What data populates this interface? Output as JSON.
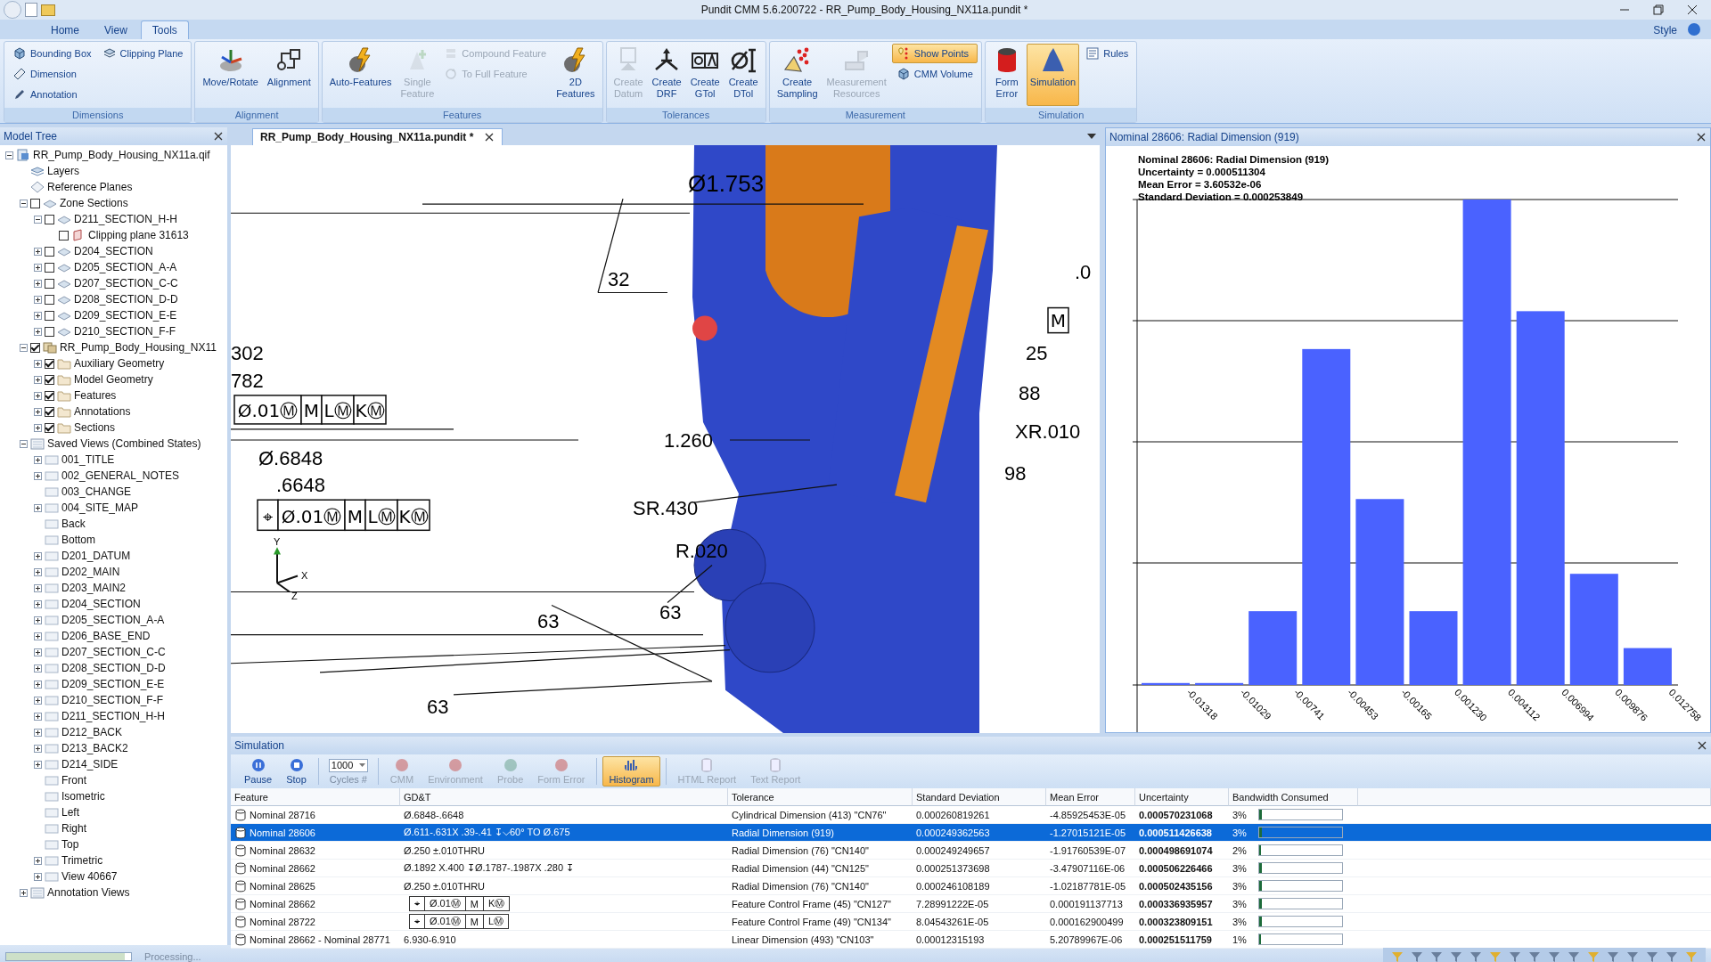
{
  "window": {
    "title": "Pundit CMM 5.6.200722 - RR_Pump_Body_Housing_NX11a.pundit *"
  },
  "ribbon_tabs": [
    {
      "label": "Home",
      "selected": false
    },
    {
      "label": "View",
      "selected": false
    },
    {
      "label": "Tools",
      "selected": true
    }
  ],
  "style_menu": "Style",
  "ribbon_groups": [
    {
      "label": "Dimensions",
      "items": [
        {
          "label": "Bounding Box",
          "kind": "small",
          "disabled": false,
          "selected": false
        },
        {
          "label": "Dimension",
          "kind": "small",
          "disabled": false,
          "selected": false
        },
        {
          "label": "Annotation",
          "kind": "small",
          "disabled": false,
          "selected": false
        },
        {
          "label": "Clipping Plane",
          "kind": "small",
          "disabled": false,
          "selected": false
        }
      ]
    },
    {
      "label": "Alignment",
      "items": [
        {
          "label": "Move/Rotate",
          "kind": "large",
          "disabled": false,
          "selected": false
        },
        {
          "label": "Alignment",
          "kind": "large",
          "disabled": false,
          "selected": false
        }
      ]
    },
    {
      "label": "Features",
      "items": [
        {
          "label": "Auto-Features",
          "kind": "large",
          "disabled": false,
          "selected": false
        },
        {
          "label": "Single\nFeature",
          "kind": "large",
          "disabled": true,
          "selected": false
        },
        {
          "label": "Compound Feature",
          "kind": "small",
          "disabled": true,
          "selected": false
        },
        {
          "label": "To Full Feature",
          "kind": "small",
          "disabled": true,
          "selected": false
        },
        {
          "label": "2D\nFeatures",
          "kind": "large",
          "disabled": false,
          "selected": false
        }
      ]
    },
    {
      "label": "Tolerances",
      "items": [
        {
          "label": "Create\nDatum",
          "kind": "large",
          "disabled": true,
          "selected": false
        },
        {
          "label": "Create\nDRF",
          "kind": "large",
          "disabled": false,
          "selected": false
        },
        {
          "label": "Create\nGTol",
          "kind": "large",
          "disabled": false,
          "selected": false
        },
        {
          "label": "Create\nDTol",
          "kind": "large",
          "disabled": false,
          "selected": false
        }
      ]
    },
    {
      "label": "Measurement",
      "items": [
        {
          "label": "Create\nSampling",
          "kind": "large",
          "disabled": false,
          "selected": false
        },
        {
          "label": "Measurement\nResources",
          "kind": "large",
          "disabled": true,
          "selected": false
        },
        {
          "label": "Show Points",
          "kind": "small",
          "disabled": false,
          "selected": true
        },
        {
          "label": "CMM Volume",
          "kind": "small",
          "disabled": false,
          "selected": false
        }
      ]
    },
    {
      "label": "Simulation",
      "items": [
        {
          "label": "Form\nError",
          "kind": "large",
          "disabled": false,
          "selected": false
        },
        {
          "label": "Simulation",
          "kind": "large",
          "disabled": false,
          "selected": true
        },
        {
          "label": "Rules",
          "kind": "small",
          "disabled": false,
          "selected": false
        }
      ]
    }
  ],
  "model_tree": {
    "title": "Model Tree",
    "items": [
      {
        "label": "RR_Pump_Body_Housing_NX11a.qif",
        "kind": "file",
        "expanded": true,
        "children": [
          {
            "label": "Layers",
            "kind": "layers"
          },
          {
            "label": "Reference Planes",
            "kind": "planes"
          },
          {
            "label": "Zone Sections",
            "kind": "section",
            "expanded": true,
            "checked": false,
            "children": [
              {
                "label": "D211_SECTION_H-H",
                "kind": "section",
                "expanded": true,
                "checked": false,
                "children": [
                  {
                    "label": "Clipping plane 31613",
                    "kind": "clip",
                    "checked": false
                  }
                ]
              },
              {
                "label": "D204_SECTION",
                "kind": "section",
                "expanded": false,
                "checked": false
              },
              {
                "label": "D205_SECTION_A-A",
                "kind": "section",
                "expanded": false,
                "checked": false
              },
              {
                "label": "D207_SECTION_C-C",
                "kind": "section",
                "expanded": false,
                "checked": false
              },
              {
                "label": "D208_SECTION_D-D",
                "kind": "section",
                "expanded": false,
                "checked": false
              },
              {
                "label": "D209_SECTION_E-E",
                "kind": "section",
                "expanded": false,
                "checked": false
              },
              {
                "label": "D210_SECTION_F-F",
                "kind": "section",
                "expanded": false,
                "checked": false
              }
            ]
          },
          {
            "label": "RR_Pump_Body_Housing_NX11",
            "kind": "part",
            "expanded": true,
            "checked": true,
            "children": [
              {
                "label": "Auxiliary Geometry",
                "kind": "folder",
                "expanded": false,
                "checked": true
              },
              {
                "label": "Model Geometry",
                "kind": "folder",
                "expanded": false,
                "checked": true
              },
              {
                "label": "Features",
                "kind": "folder",
                "expanded": false,
                "checked": true
              },
              {
                "label": "Annotations",
                "kind": "folder",
                "expanded": false,
                "checked": true
              },
              {
                "label": "Sections",
                "kind": "folder",
                "expanded": false,
                "checked": true
              }
            ]
          },
          {
            "label": "Saved Views (Combined States)",
            "kind": "views",
            "expanded": true,
            "children": [
              {
                "label": "001_TITLE",
                "kind": "view",
                "expanded": false
              },
              {
                "label": "002_GENERAL_NOTES",
                "kind": "view",
                "expanded": false
              },
              {
                "label": "003_CHANGE",
                "kind": "view"
              },
              {
                "label": "004_SITE_MAP",
                "kind": "view",
                "expanded": false
              },
              {
                "label": "Back",
                "kind": "view"
              },
              {
                "label": "Bottom",
                "kind": "view"
              },
              {
                "label": "D201_DATUM",
                "kind": "view",
                "expanded": false
              },
              {
                "label": "D202_MAIN",
                "kind": "view",
                "expanded": false
              },
              {
                "label": "D203_MAIN2",
                "kind": "view",
                "expanded": false
              },
              {
                "label": "D204_SECTION",
                "kind": "view",
                "expanded": false
              },
              {
                "label": "D205_SECTION_A-A",
                "kind": "view",
                "expanded": false
              },
              {
                "label": "D206_BASE_END",
                "kind": "view",
                "expanded": false
              },
              {
                "label": "D207_SECTION_C-C",
                "kind": "view",
                "expanded": false
              },
              {
                "label": "D208_SECTION_D-D",
                "kind": "view",
                "expanded": false
              },
              {
                "label": "D209_SECTION_E-E",
                "kind": "view",
                "expanded": false
              },
              {
                "label": "D210_SECTION_F-F",
                "kind": "view",
                "expanded": false
              },
              {
                "label": "D211_SECTION_H-H",
                "kind": "view",
                "expanded": false
              },
              {
                "label": "D212_BACK",
                "kind": "view",
                "expanded": false
              },
              {
                "label": "D213_BACK2",
                "kind": "view",
                "expanded": false
              },
              {
                "label": "D214_SIDE",
                "kind": "view",
                "expanded": false
              },
              {
                "label": "Front",
                "kind": "view"
              },
              {
                "label": "Isometric",
                "kind": "view"
              },
              {
                "label": "Left",
                "kind": "view"
              },
              {
                "label": "Right",
                "kind": "view"
              },
              {
                "label": "Top",
                "kind": "view"
              },
              {
                "label": "Trimetric",
                "kind": "view",
                "expanded": false
              },
              {
                "label": "View 40667",
                "kind": "view",
                "expanded": false
              }
            ]
          },
          {
            "label": "Annotation Views",
            "kind": "views",
            "expanded": false
          }
        ]
      }
    ]
  },
  "document_tab": {
    "label": "RR_Pump_Body_Housing_NX11a.pundit *"
  },
  "viewport": {
    "annotations": [
      "Ø1.753",
      "32",
      "302",
      "782",
      "Ø.6848",
      ".6648",
      "1.260",
      "SR.430",
      "R.020",
      "63",
      "63",
      "63",
      ".0",
      "25",
      "88",
      "XR.010",
      "98"
    ],
    "frames": [
      [
        "Ø.01Ⓜ",
        "M",
        "LⓂ",
        "KⓂ"
      ],
      [
        "⌖",
        "Ø.01Ⓜ",
        "M",
        "LⓂ",
        "KⓂ"
      ],
      [
        "M"
      ]
    ],
    "axes": [
      "Y",
      "X",
      "Z"
    ]
  },
  "histogram_panel": {
    "title": "Nominal 28606: Radial Dimension (919)",
    "summary": [
      "Nominal 28606: Radial Dimension (919)",
      "Uncertainty = 0.000511304",
      "Mean Error = 3.60532e-06",
      "Standard Deviation = 0.000253849"
    ],
    "bin_labels": [
      "-0.01318",
      "-0.01029",
      "-0.00741",
      "-0.00453",
      "-0.00165",
      "0.001230",
      "0.004112",
      "0.006994",
      "0.009876",
      "0.012758"
    ]
  },
  "simulation": {
    "title": "Simulation",
    "toolbar": [
      {
        "label": "Pause",
        "kind": "button",
        "disabled": false,
        "selected": false
      },
      {
        "label": "Stop",
        "kind": "button",
        "disabled": false,
        "selected": false
      },
      {
        "label": "Cycles #",
        "kind": "dropdown",
        "value": "1000",
        "disabled": false,
        "selected": false
      },
      {
        "label": "CMM",
        "kind": "button",
        "disabled": true,
        "selected": false
      },
      {
        "label": "Environment",
        "kind": "button",
        "disabled": true,
        "selected": false
      },
      {
        "label": "Probe",
        "kind": "button",
        "disabled": true,
        "selected": false
      },
      {
        "label": "Form Error",
        "kind": "button",
        "disabled": true,
        "selected": false
      },
      {
        "label": "Histogram",
        "kind": "button",
        "disabled": false,
        "selected": true
      },
      {
        "label": "HTML Report",
        "kind": "button",
        "disabled": true,
        "selected": false
      },
      {
        "label": "Text Report",
        "kind": "button",
        "disabled": true,
        "selected": false
      }
    ],
    "columns": [
      "Feature",
      "GD&T",
      "Tolerance",
      "Standard Deviation",
      "Mean Error",
      "Uncertainty",
      "Bandwidth Consumed"
    ],
    "rows": [
      {
        "feature": "Nominal 28716",
        "gdt": {
          "kind": "text",
          "text": "Ø.6848-.6648"
        },
        "tolerance": "Cylindrical Dimension (413) \"CN76\"",
        "std_dev": "0.000260819261",
        "mean_error": "-4.85925453E-05",
        "uncertainty": "0.000570231068",
        "bandwidth": "3%",
        "level": 0.03,
        "selected": false
      },
      {
        "feature": "Nominal 28606",
        "gdt": {
          "kind": "text",
          "text": "Ø.611-.631X  .39-.41  ↧⌵60°  TO  Ø.675"
        },
        "tolerance": "Radial Dimension (919)",
        "std_dev": "0.000249362563",
        "mean_error": "-1.27015121E-05",
        "uncertainty": "0.000511426638",
        "bandwidth": "3%",
        "level": 0.03,
        "selected": true
      },
      {
        "feature": "Nominal 28632",
        "gdt": {
          "kind": "text",
          "text": "Ø.250  ±.010THRU"
        },
        "tolerance": "Radial Dimension (76) \"CN140\"",
        "std_dev": "0.000249249657",
        "mean_error": "-1.91760539E-07",
        "uncertainty": "0.000498691074",
        "bandwidth": "2%",
        "level": 0.02,
        "selected": false
      },
      {
        "feature": "Nominal 28662",
        "gdt": {
          "kind": "text",
          "text": "Ø.1892  X.400  ↧Ø.1787-.1987X  .280  ↧"
        },
        "tolerance": "Radial Dimension (44) \"CN125\"",
        "std_dev": "0.000251373698",
        "mean_error": "-3.47907116E-06",
        "uncertainty": "0.000506226466",
        "bandwidth": "3%",
        "level": 0.03,
        "selected": false
      },
      {
        "feature": "Nominal 28625",
        "gdt": {
          "kind": "text",
          "text": "Ø.250  ±.010THRU"
        },
        "tolerance": "Radial Dimension (76) \"CN140\"",
        "std_dev": "0.000246108189",
        "mean_error": "-1.02187781E-05",
        "uncertainty": "0.000502435156",
        "bandwidth": "3%",
        "level": 0.03,
        "selected": false
      },
      {
        "feature": "Nominal 28662",
        "gdt": {
          "kind": "frame",
          "cells": [
            "⌖",
            "Ø.01Ⓜ",
            "M",
            "KⓂ"
          ]
        },
        "tolerance": "Feature Control Frame (45) \"CN127\"",
        "std_dev": "7.28991222E-05",
        "mean_error": "0.000191137713",
        "uncertainty": "0.000336935957",
        "bandwidth": "3%",
        "level": 0.03,
        "selected": false
      },
      {
        "feature": "Nominal 28722",
        "gdt": {
          "kind": "frame",
          "cells": [
            "⌖",
            "Ø.01Ⓜ",
            "M",
            "LⓂ"
          ]
        },
        "tolerance": "Feature Control Frame (49) \"CN134\"",
        "std_dev": "8.04543261E-05",
        "mean_error": "0.000162900499",
        "uncertainty": "0.000323809151",
        "bandwidth": "3%",
        "level": 0.03,
        "selected": false
      },
      {
        "feature": "Nominal 28662 - Nominal 28771",
        "gdt": {
          "kind": "text",
          "text": "6.930-6.910"
        },
        "tolerance": "Linear Dimension (493) \"CN103\"",
        "std_dev": "0.00012315193",
        "mean_error": "5.20789967E-06",
        "uncertainty": "0.000251511759",
        "bandwidth": "1%",
        "level": 0.01,
        "selected": false
      }
    ]
  },
  "status_bar": {
    "text": "Processing...",
    "level": 0.95
  }
}
